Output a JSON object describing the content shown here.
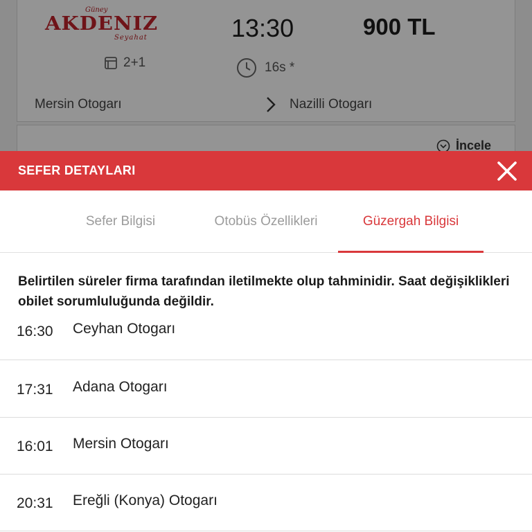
{
  "trip": {
    "company": {
      "top": "Güney",
      "name": "AKDENIZ",
      "bottom": "Seyahat"
    },
    "seat_layout": "2+1",
    "departure_time": "13:30",
    "price": "900 TL",
    "duration": "16s *",
    "from": "Mersin Otogarı",
    "to": "Nazilli Otogarı",
    "inspect_label": "İncele"
  },
  "sheet": {
    "title": "SEFER DETAYLARI",
    "tabs": [
      {
        "label": "Sefer Bilgisi",
        "active": false
      },
      {
        "label": "Otobüs Özellikleri",
        "active": false
      },
      {
        "label": "Güzergah Bilgisi",
        "active": true
      }
    ],
    "notice": "Belirtilen süreler firma tarafından iletilmekte olup tahminidir. Saat değişiklikleri obilet sorumluluğunda değildir.",
    "stops": [
      {
        "time": "16:30",
        "name": "Ceyhan Otogarı"
      },
      {
        "time": "17:31",
        "name": "Adana Otogarı"
      },
      {
        "time": "16:01",
        "name": "Mersin Otogarı"
      },
      {
        "time": "20:31",
        "name": "Ereğli (Konya) Otogarı"
      }
    ]
  },
  "icons": {
    "seat": "seat-icon",
    "clock": "clock-icon",
    "chevron": "chevron-right-icon",
    "inspect": "chevron-circle-icon",
    "close": "close-icon"
  },
  "colors": {
    "brand_red": "#d9383b",
    "logo_red": "#c0232b",
    "inactive_tab": "#9b9b9b"
  }
}
